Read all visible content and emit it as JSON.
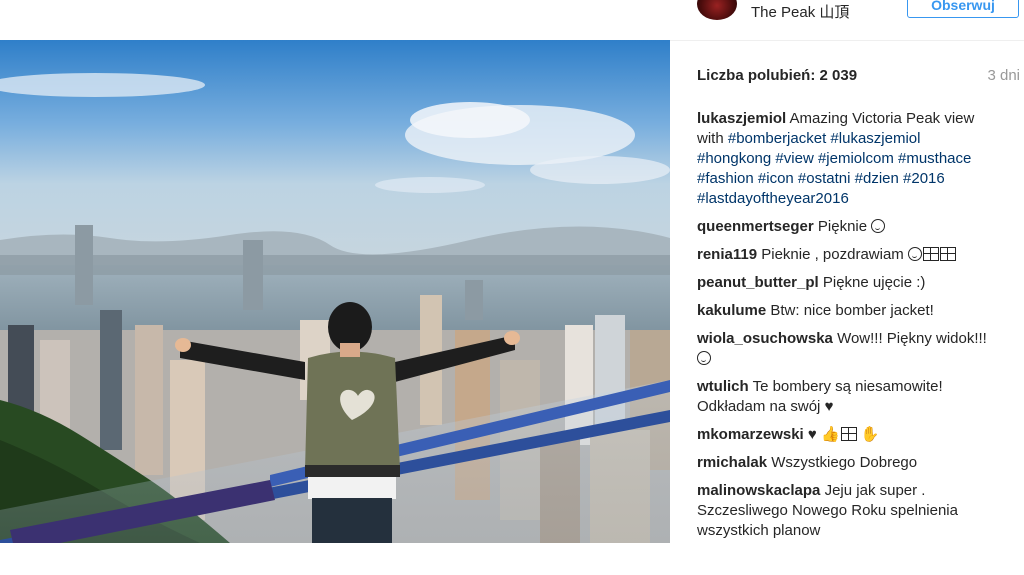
{
  "header": {
    "location": "The Peak 山頂",
    "follow_label": "Obserwuj"
  },
  "post": {
    "likes_label": "Liczba polubień: 2 039",
    "time_ago": "3 dni",
    "caption": {
      "username": "lukaszjemiol",
      "text": "Amazing Victoria Peak view with",
      "hashtags": [
        "#bomberjacket",
        "#lukaszjemiol",
        "#hongkong",
        "#view",
        "#jemiolcom",
        "#musthace",
        "#fashion",
        "#icon",
        "#ostatni",
        "#dzien",
        "#2016",
        "#lastdayoftheyear2016"
      ]
    },
    "comments": [
      {
        "user": "queenmertseger",
        "text": "Pięknie"
      },
      {
        "user": "renia119",
        "text": "Pieknie , pozdrawiam"
      },
      {
        "user": "peanut_butter_pl",
        "text": "Piękne ujęcie :)"
      },
      {
        "user": "kakulume",
        "text": "Btw: nice bomber jacket!"
      },
      {
        "user": "wiola_osuchowska",
        "text": "Wow!!! Piękny widok!!!"
      },
      {
        "user": "wtulich",
        "text": "Te bombery są niesamowite! Odkładam na swój"
      },
      {
        "user": "mkomarzewski",
        "text": ""
      },
      {
        "user": "rmichalak",
        "text": "Wszystkiego Dobrego"
      },
      {
        "user": "malinowskaclapa",
        "text": "Jeju jak super . Szczesliwego Nowego Roku spelnienia wszystkich planow"
      }
    ]
  },
  "colors": {
    "accent": "#3897f0",
    "hashtag": "#003569",
    "muted": "#999999",
    "text": "#262626"
  }
}
